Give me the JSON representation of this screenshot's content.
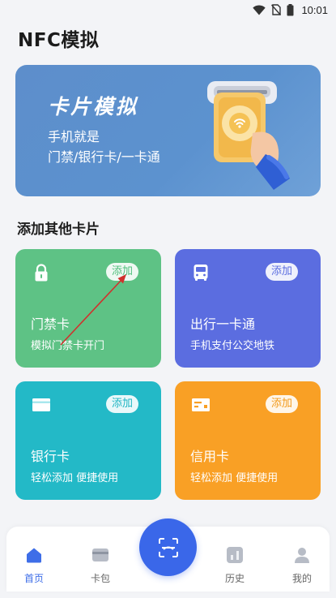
{
  "status_bar": {
    "time": "10:01",
    "icons": [
      "wifi-icon",
      "no-sim-icon",
      "battery-icon"
    ]
  },
  "page_title": "NFC模拟",
  "banner": {
    "title": "卡片模拟",
    "subtitle_line1": "手机就是",
    "subtitle_line2": "门禁/银行卡/一卡通"
  },
  "section_title": "添加其他卡片",
  "cards": [
    {
      "title": "门禁卡",
      "subtitle": "模拟门禁卡开门",
      "button": "添加",
      "icon": "lock-icon",
      "color": "#5ec285"
    },
    {
      "title": "出行一卡通",
      "subtitle": "手机支付公交地铁",
      "button": "添加",
      "icon": "bus-icon",
      "color": "#5b6de0"
    },
    {
      "title": "银行卡",
      "subtitle": "轻松添加 便捷使用",
      "button": "添加",
      "icon": "card-icon",
      "color": "#23b9c7"
    },
    {
      "title": "信用卡",
      "subtitle": "轻松添加 便捷使用",
      "button": "添加",
      "icon": "credit-card-icon",
      "color": "#f9a025"
    }
  ],
  "nav": {
    "items": [
      {
        "label": "首页",
        "icon": "home-icon",
        "active": true
      },
      {
        "label": "卡包",
        "icon": "wallet-icon",
        "active": false
      },
      {
        "label": "历史",
        "icon": "history-icon",
        "active": false
      },
      {
        "label": "我的",
        "icon": "profile-icon",
        "active": false
      }
    ],
    "center_icon": "scan-icon"
  },
  "colors": {
    "accent": "#3a67e9",
    "annotation_arrow": "#d0312d"
  }
}
